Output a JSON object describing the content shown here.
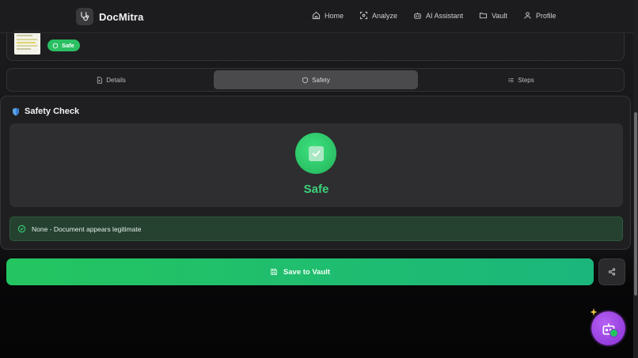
{
  "brand": {
    "name": "DocMitra"
  },
  "nav": [
    {
      "label": "Home",
      "icon": "home-icon"
    },
    {
      "label": "Analyze",
      "icon": "scan-icon"
    },
    {
      "label": "AI Assistant",
      "icon": "robot-icon"
    },
    {
      "label": "Vault",
      "icon": "folder-icon"
    },
    {
      "label": "Profile",
      "icon": "user-icon"
    }
  ],
  "document": {
    "badge": "Safe"
  },
  "tabs": [
    {
      "label": "Details",
      "icon": "file-icon",
      "active": false
    },
    {
      "label": "Safety",
      "icon": "shield-icon",
      "active": true
    },
    {
      "label": "Steps",
      "icon": "list-icon",
      "active": false
    }
  ],
  "safety": {
    "title": "Safety Check",
    "status": "Safe",
    "finding": "None - Document appears legitimate"
  },
  "actions": {
    "save_label": "Save to Vault"
  },
  "colors": {
    "accent_green": "#22c55e",
    "assistant_purple": "#9b3fe0"
  }
}
